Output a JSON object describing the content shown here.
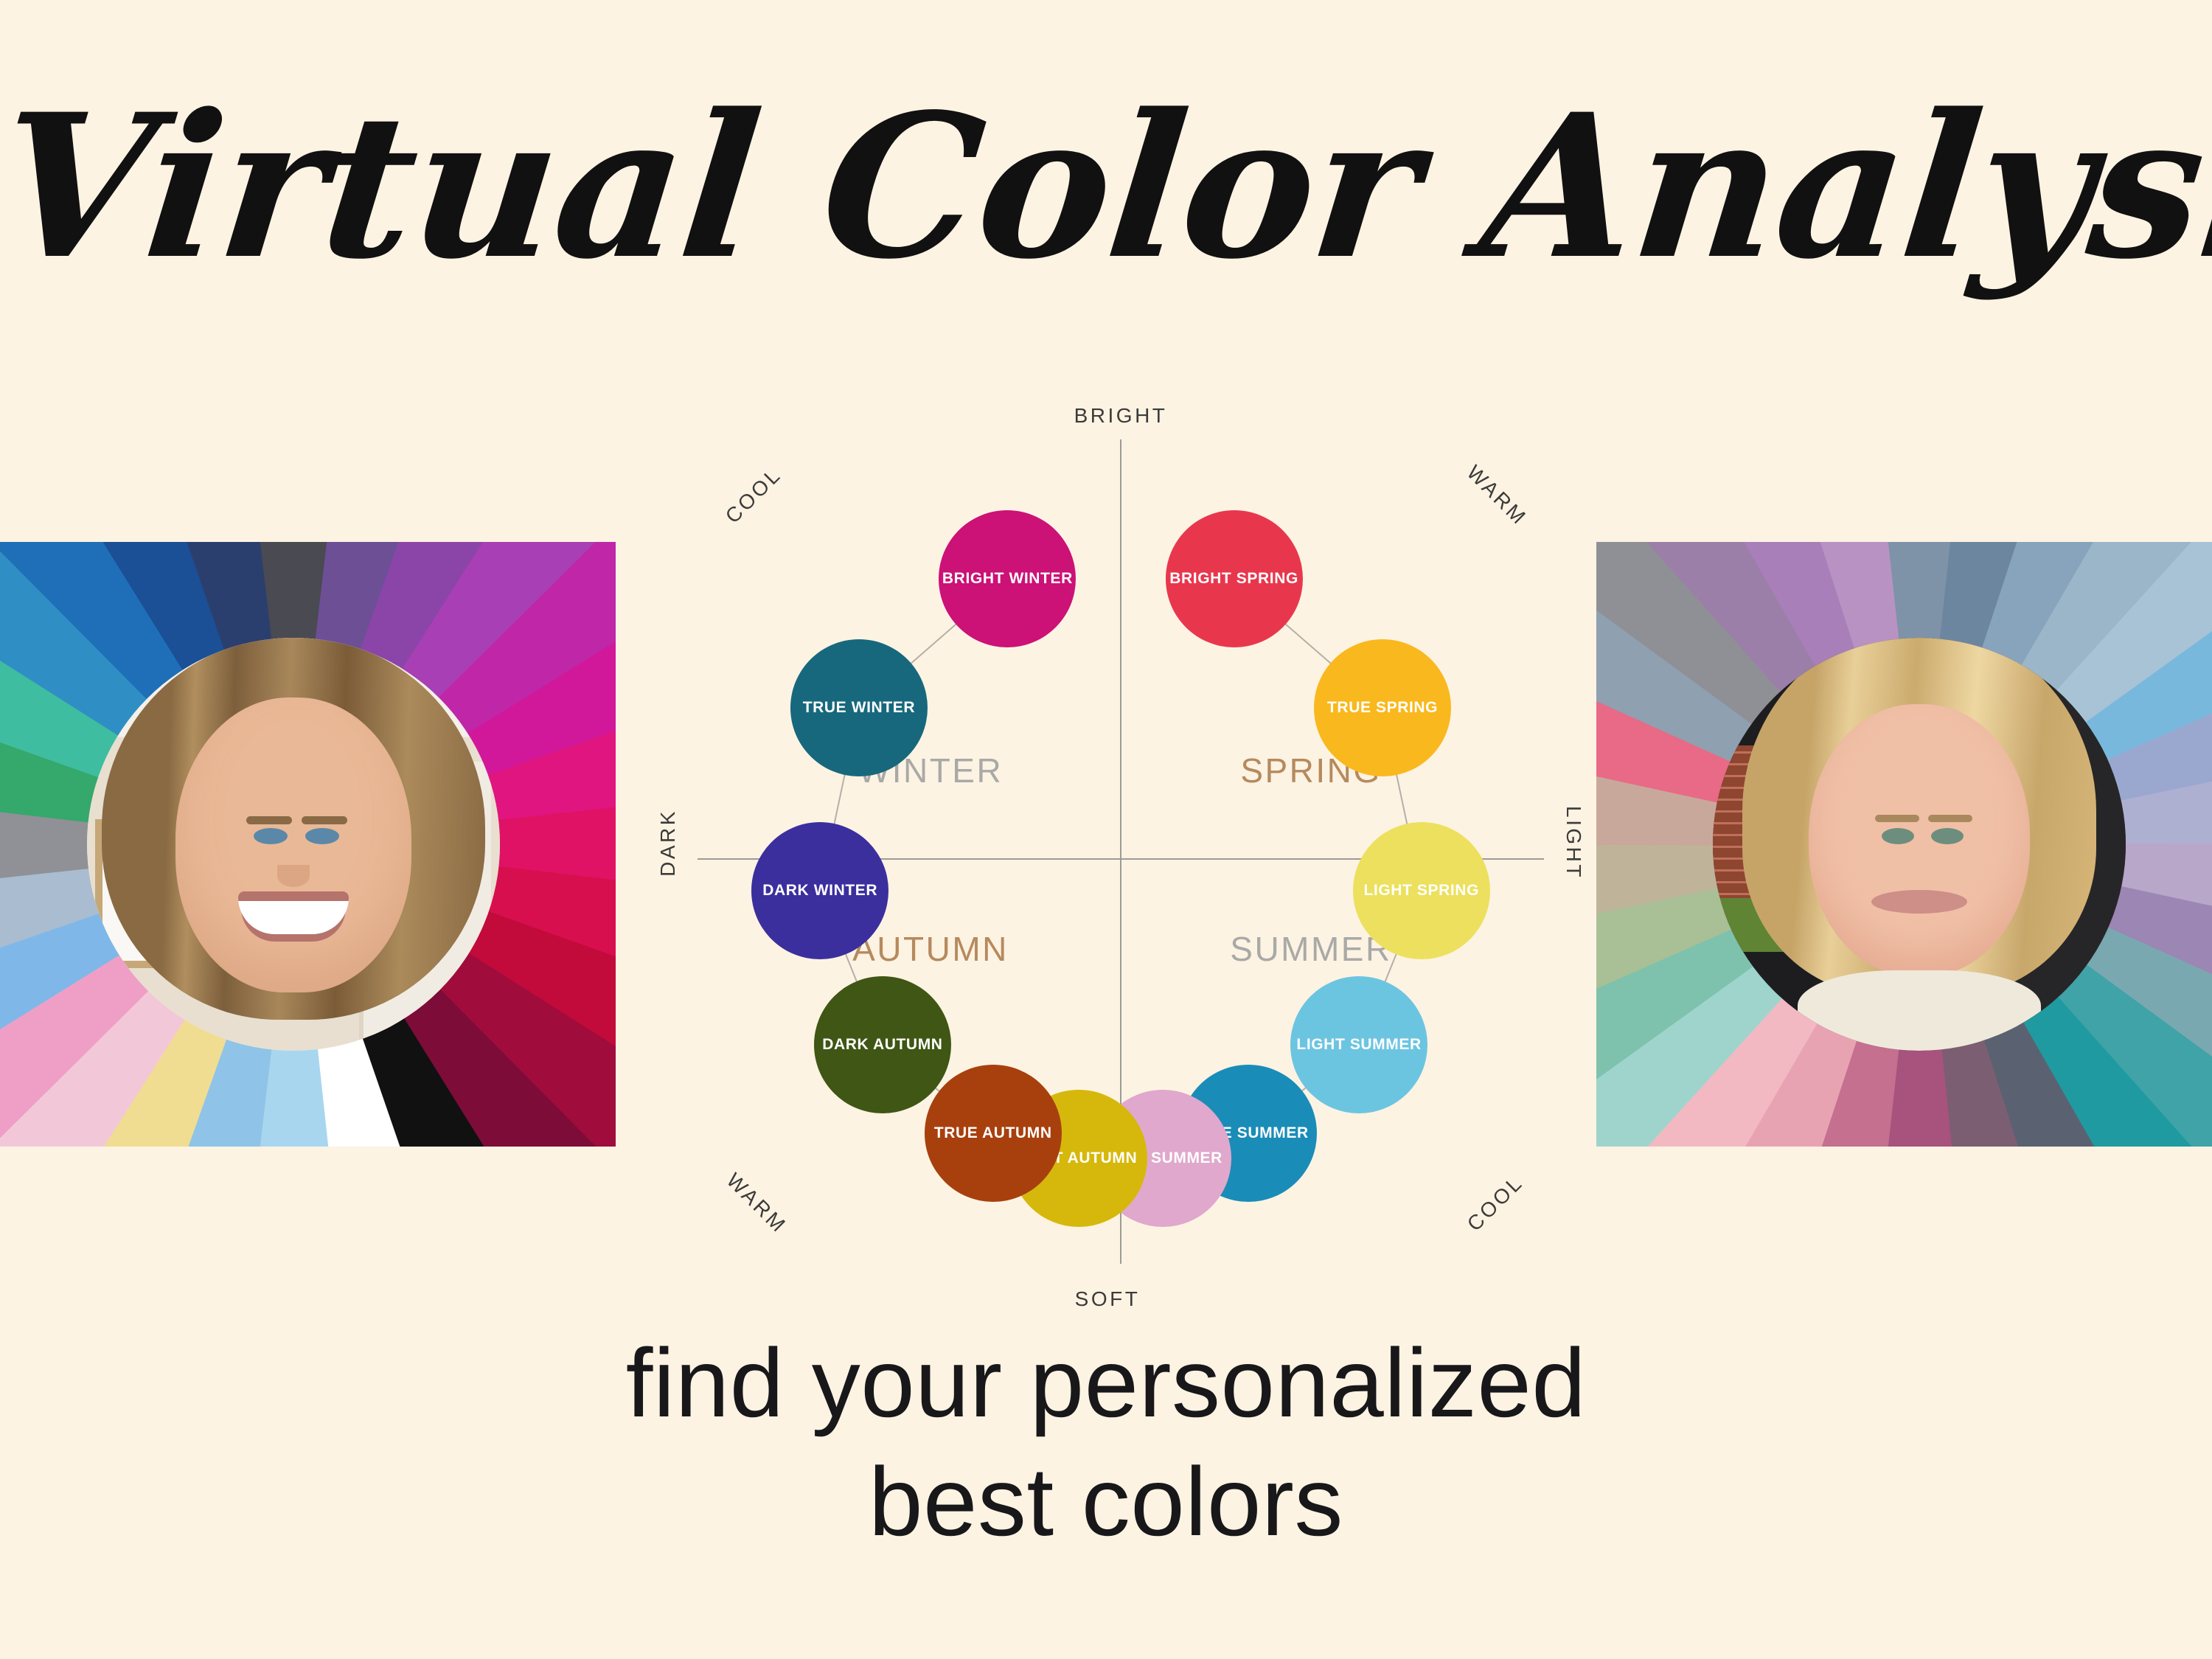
{
  "header": {
    "title": "Virtual Color Analysis"
  },
  "footer": {
    "line1": "find your personalized",
    "line2": "best colors"
  },
  "background_color": "#fdf3e3",
  "wheel": {
    "axis_labels": [
      {
        "text": "BRIGHT",
        "position": "top",
        "rotation": 0
      },
      {
        "text": "SOFT",
        "position": "bottom",
        "rotation": 0
      },
      {
        "text": "DARK",
        "position": "left",
        "rotation": -90
      },
      {
        "text": "LIGHT",
        "position": "right",
        "rotation": 90
      },
      {
        "text": "COOL",
        "position": "top-left",
        "rotation": -45
      },
      {
        "text": "WARM",
        "position": "top-right",
        "rotation": 45
      },
      {
        "text": "WARM",
        "position": "bottom-left",
        "rotation": 45
      },
      {
        "text": "COOL",
        "position": "bottom-right",
        "rotation": -45
      }
    ],
    "quadrants": [
      {
        "name": "WINTER",
        "color": "#a9a9a7"
      },
      {
        "name": "SPRING",
        "color": "#b58a5e"
      },
      {
        "name": "AUTUMN",
        "color": "#b58a5e"
      },
      {
        "name": "SUMMER",
        "color": "#a9a9a7"
      }
    ],
    "seasons": [
      {
        "label": "BRIGHT WINTER",
        "color": "#cc1177",
        "quadrant": "WINTER"
      },
      {
        "label": "TRUE WINTER",
        "color": "#17687d",
        "quadrant": "WINTER"
      },
      {
        "label": "DARK WINTER",
        "color": "#3b2f9e",
        "quadrant": "WINTER"
      },
      {
        "label": "BRIGHT SPRING",
        "color": "#e8374d",
        "quadrant": "SPRING"
      },
      {
        "label": "TRUE SPRING",
        "color": "#f9b81e",
        "quadrant": "SPRING"
      },
      {
        "label": "LIGHT SPRING",
        "color": "#ece05e",
        "quadrant": "SPRING"
      },
      {
        "label": "LIGHT SUMMER",
        "color": "#6cc5e0",
        "quadrant": "SUMMER"
      },
      {
        "label": "TRUE SUMMER",
        "color": "#1a8cb8",
        "quadrant": "SUMMER"
      },
      {
        "label": "SOFT SUMMER",
        "color": "#e0a8cc",
        "quadrant": "SUMMER"
      },
      {
        "label": "SOFT AUTUMN",
        "color": "#d6b80c",
        "quadrant": "AUTUMN"
      },
      {
        "label": "TRUE AUTUMN",
        "color": "#a8400e",
        "quadrant": "AUTUMN"
      },
      {
        "label": "DARK AUTUMN",
        "color": "#3f5614",
        "quadrant": "AUTUMN"
      }
    ]
  },
  "photos": {
    "left": {
      "palette_type": "bright-cool-winter",
      "ray_colors": [
        "#4a4a52",
        "#6d4f96",
        "#8b45a8",
        "#a93fb5",
        "#c026a8",
        "#d1189a",
        "#e0157f",
        "#e01266",
        "#d80f4e",
        "#c20b3b",
        "#a00c3c",
        "#7d0c38",
        "#111111",
        "#ffffff",
        "#a8d6ef",
        "#8fc4e8",
        "#f0dd92",
        "#f2c8d8",
        "#ef9fc6",
        "#7fb8e8",
        "#a9bcd0",
        "#8f9196",
        "#35a86b",
        "#3fbda0",
        "#2f8fc4",
        "#1f6fb8",
        "#1b4f96",
        "#2b3f6e"
      ]
    },
    "right": {
      "palette_type": "soft-cool-summer",
      "ray_colors": [
        "#7e93a8",
        "#6d86a0",
        "#88a4bc",
        "#9cb6c9",
        "#a8c3d6",
        "#79b8dd",
        "#9aa8cf",
        "#aeb0d2",
        "#b8a7c8",
        "#9b86b4",
        "#7aa8b0",
        "#3fa3a8",
        "#1f9aa0",
        "#5a6272",
        "#7c5e72",
        "#a8527e",
        "#c4708e",
        "#e8a3b2",
        "#f2b9c2",
        "#9fd4cc",
        "#7ec2ad",
        "#a9bf96",
        "#bfb49a",
        "#c9a89c",
        "#e86a86",
        "#8fa0b0",
        "#8f8f96",
        "#9c7fa8",
        "#a87fb8",
        "#b992c4"
      ]
    }
  }
}
